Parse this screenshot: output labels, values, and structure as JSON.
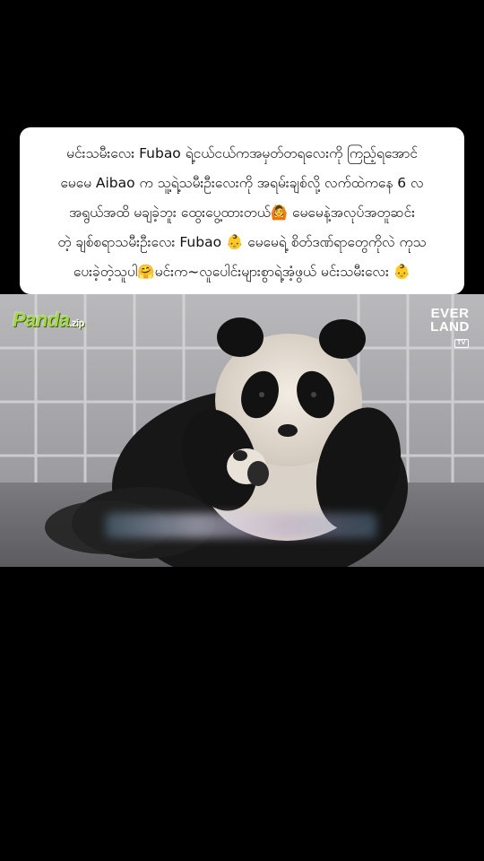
{
  "caption": {
    "lines": [
      "မင်းသမီးလေး Fubao ရဲ့ငယ်ငယ်ကအမှတ်တရလေးကို ကြည့်ရအောင်",
      "မေမေ Aibao က သူ့ရဲ့သမီးဦးလေးကို အရမ်းချစ်လို့ လက်ထဲကနေ 6 လ",
      "အရွယ်အထိ မချခဲ့ဘူး ထွေးပွေ့ထားတယ်🙆 မေမေနဲ့အလုပ်အတူဆင်း",
      "တဲ့ ချစ်စရာသမီးဦးလေး Fubao 👶 မေမေရဲ့ စိတ်ဒဏ်ရာတွေကိုလဲ ကုသ",
      "ပေးခဲ့တဲ့သူပါ🤗မင်းက~လူပေါင်းများစွာရဲ့အံ့ဖွယ် မင်းသမီးလေး 👶"
    ]
  },
  "video": {
    "watermark_left": "Panda",
    "watermark_left_suffix": ".zip",
    "watermark_right_top": "EVER",
    "watermark_right_bottom": "LAND",
    "watermark_right_tv": "TV"
  },
  "colors": {
    "background": "#000000",
    "caption_bg": "#ffffff",
    "logo_green": "#a4d64a"
  }
}
